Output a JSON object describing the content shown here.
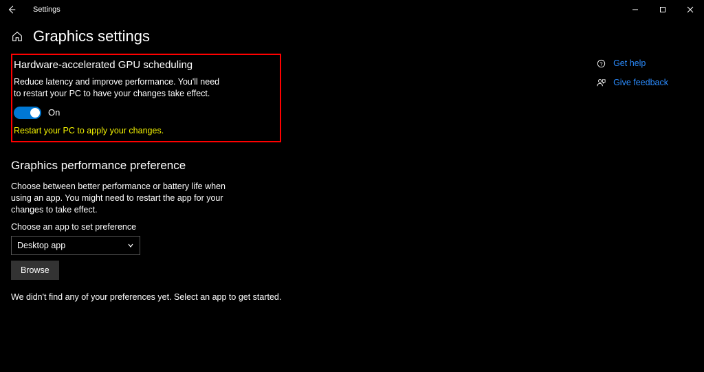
{
  "titlebar": {
    "app_title": "Settings"
  },
  "header": {
    "page_title": "Graphics settings"
  },
  "gpu": {
    "title": "Hardware-accelerated GPU scheduling",
    "desc": "Reduce latency and improve performance. You'll need to restart your PC to have your changes take effect.",
    "toggle_state": "On",
    "warning": "Restart your PC to apply your changes."
  },
  "perf": {
    "title": "Graphics performance preference",
    "desc": "Choose between better performance or battery life when using an app. You might need to restart the app for your changes to take effect.",
    "field_label": "Choose an app to set preference",
    "combobox_value": "Desktop app",
    "browse_label": "Browse",
    "empty_msg": "We didn't find any of your preferences yet. Select an app to get started."
  },
  "side": {
    "help": "Get help",
    "feedback": "Give feedback"
  }
}
